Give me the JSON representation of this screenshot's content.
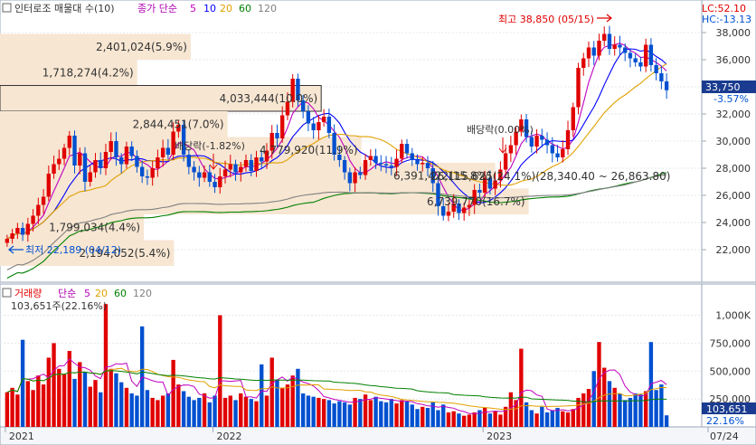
{
  "price_legend": {
    "title": "인터로조 매물대 수(10)",
    "ma_prefix": "종가 단순",
    "ma_periods": [
      "5",
      "10",
      "20",
      "60",
      "120"
    ],
    "ma_colors": [
      "#c000c0",
      "#0000ff",
      "#e0a000",
      "#008000",
      "#808080"
    ]
  },
  "lc_label": "LC:52.10",
  "hc_label": "HC:-13.13",
  "volume_legend": {
    "title": "거래량",
    "ma_prefix": "단순",
    "ma_periods": [
      "5",
      "20",
      "60",
      "120"
    ],
    "ma_colors": [
      "#c000c0",
      "#e0a000",
      "#008000",
      "#808080"
    ],
    "last_value": "103,651주(22.16%)"
  },
  "annotations": {
    "high": "최고 38,850 (05/15)",
    "low": "최저 22,189 (04/12)",
    "dividend1": "배당락(-1.82%)",
    "dividend2": "배당락(0.00%)",
    "range": "26,115,625(24.1%)(28,340.40 ~ 26,863.80)"
  },
  "current_price": "33,750",
  "current_change": "-3.57%",
  "volume_current": "103,651",
  "volume_current_pct": "22.16%",
  "colors": {
    "up": "#e00000",
    "down": "#0050d0",
    "profile": "#f7e6d2",
    "current_box": "#1a3b8f"
  },
  "chart_data": {
    "type": "candlestick+volume",
    "price_axis": {
      "ticks": [
        22000,
        24000,
        26000,
        28000,
        30000,
        32000,
        34000,
        36000,
        38000
      ],
      "range": [
        20000,
        39200
      ]
    },
    "volume_axis": {
      "ticks": [
        "250,000",
        "500,000",
        "750,000",
        "1,000K"
      ],
      "range": [
        0,
        1150000
      ]
    },
    "x_labels": [
      "2021",
      "2022",
      "2023",
      "07/24"
    ],
    "volume_profile": [
      {
        "label": "2,401,024(5.9%)",
        "low": 36000,
        "high": 37900
      },
      {
        "label": "1,718,274(4.2%)",
        "low": 34100,
        "high": 36000
      },
      {
        "label": "4,033,444(10.0%)",
        "low": 32200,
        "high": 34100
      },
      {
        "label": "2,844,451(7.0%)",
        "low": 30300,
        "high": 32200
      },
      {
        "label": "4,779,920(11.9%)",
        "low": 28400,
        "high": 30300
      },
      {
        "label": "6,391,422(15.8%)",
        "low": 26500,
        "high": 28400
      },
      {
        "label": "6,739,770(16.7%)",
        "low": 24600,
        "high": 26500
      },
      {
        "label": "1,799,034(4.4%)",
        "low": 22700,
        "high": 24600
      },
      {
        "label": "2,194,052(5.4%)",
        "low": 20800,
        "high": 22700
      }
    ],
    "closes": [
      22800,
      23200,
      23600,
      23100,
      23900,
      24500,
      25300,
      25900,
      27600,
      28300,
      28700,
      29500,
      30400,
      28200,
      29100,
      27000,
      27700,
      28600,
      28000,
      29200,
      30000,
      28800,
      28300,
      29600,
      28900,
      28100,
      27400,
      27300,
      28000,
      28800,
      29500,
      29000,
      30700,
      31200,
      29000,
      28100,
      27700,
      27300,
      27700,
      27000,
      26600,
      27400,
      27900,
      28300,
      27700,
      28100,
      28600,
      27800,
      28800,
      28500,
      29300,
      30600,
      30200,
      31900,
      32900,
      34600,
      33000,
      32200,
      31300,
      30800,
      31400,
      31800,
      30600,
      29000,
      28600,
      27700,
      26900,
      27700,
      27500,
      28600,
      28900,
      28400,
      28300,
      28200,
      28100,
      28700,
      29800,
      29100,
      28600,
      28300,
      28400,
      28000,
      26900,
      25200,
      24500,
      24800,
      25400,
      24700,
      25100,
      25300,
      26400,
      26200,
      27300,
      26500,
      27100,
      27900,
      29100,
      29700,
      30700,
      31600,
      30300,
      29600,
      30400,
      30100,
      29700,
      29100,
      28800,
      29400,
      30800,
      32500,
      35400,
      36100,
      36900,
      36300,
      37400,
      37900,
      36800,
      37100,
      36900,
      36500,
      36100,
      35800,
      35500,
      37100,
      35600,
      35000,
      34400,
      33750
    ],
    "volumes": [
      310000,
      350000,
      290000,
      780000,
      410000,
      330000,
      460000,
      380000,
      620000,
      750000,
      520000,
      470000,
      680000,
      430000,
      580000,
      490000,
      360000,
      420000,
      310000,
      1100000,
      520000,
      480000,
      400000,
      350000,
      300000,
      280000,
      900000,
      330000,
      260000,
      240000,
      280000,
      300000,
      600000,
      380000,
      320000,
      270000,
      240000,
      260000,
      300000,
      220000,
      280000,
      1000000,
      260000,
      280000,
      240000,
      300000,
      270000,
      250000,
      230000,
      560000,
      280000,
      620000,
      420000,
      350000,
      380000,
      460000,
      520000,
      300000,
      280000,
      270000,
      260000,
      250000,
      240000,
      210000,
      230000,
      220000,
      200000,
      260000,
      250000,
      290000,
      240000,
      270000,
      230000,
      220000,
      250000,
      210000,
      240000,
      230000,
      200000,
      160000,
      180000,
      170000,
      220000,
      150000,
      200000,
      130000,
      140000,
      120000,
      100000,
      110000,
      130000,
      150000,
      170000,
      120000,
      140000,
      110000,
      180000,
      310000,
      240000,
      700000,
      220000,
      150000,
      120000,
      180000,
      130000,
      150000,
      170000,
      140000,
      130000,
      160000,
      260000,
      300000,
      340000,
      500000,
      760000,
      530000,
      410000,
      350000,
      300000,
      240000,
      260000,
      300000,
      290000,
      320000,
      760000,
      330000,
      380000,
      103651
    ]
  }
}
